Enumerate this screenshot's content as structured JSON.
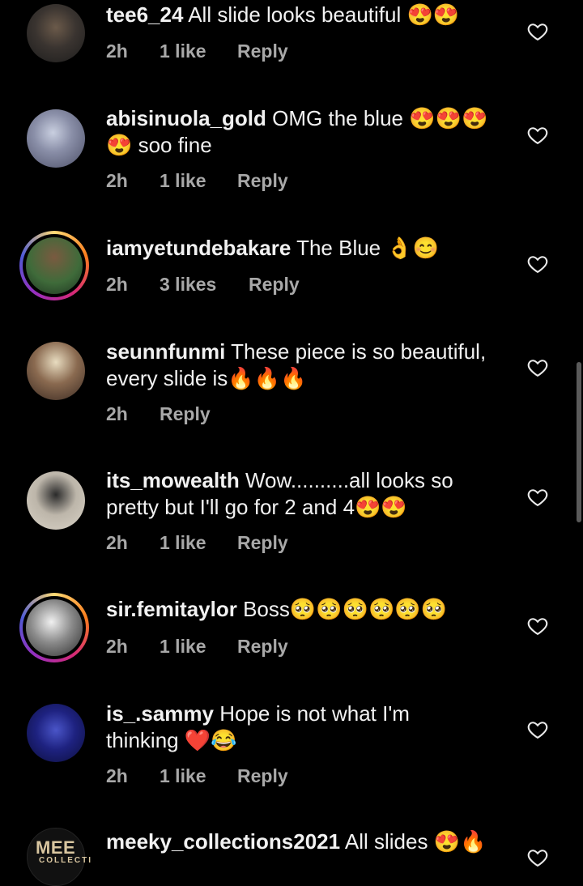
{
  "comments": [
    {
      "username": "tee6_24",
      "text": " All slide looks beautiful 😍😍",
      "time": "2h",
      "likes": "1 like",
      "reply": "Reply"
    },
    {
      "username": "abisinuola_gold",
      "text": " OMG the blue 😍😍😍 😍 soo fine",
      "time": "2h",
      "likes": "1 like",
      "reply": "Reply"
    },
    {
      "username": "iamyetundebakare",
      "text": " The Blue 👌😊",
      "time": "2h",
      "likes": "3 likes",
      "reply": "Reply"
    },
    {
      "username": "seunnfunmi",
      "text": " These piece is so beautiful, every slide is🔥🔥🔥",
      "time": "2h",
      "likes": "",
      "reply": "Reply"
    },
    {
      "username": "its_mowealth",
      "text": " Wow..........all looks so pretty but I'll go for 2 and 4😍😍",
      "time": "2h",
      "likes": "1 like",
      "reply": "Reply"
    },
    {
      "username": "sir.femitaylor",
      "text": " Boss🥺🥺🥺🥺🥺🥺",
      "time": "2h",
      "likes": "1 like",
      "reply": "Reply"
    },
    {
      "username": "is_.sammy",
      "text": " Hope  is not what I'm thinking ❤️😂",
      "time": "2h",
      "likes": "1 like",
      "reply": "Reply"
    },
    {
      "username": "meeky_collections2021",
      "text": " All slides 😍🔥",
      "time": "",
      "likes": "",
      "reply": ""
    }
  ],
  "logo": {
    "line1": "MEE",
    "line2": "COLLECTI"
  },
  "colors": {
    "background": "#000000",
    "text": "#f1f1f1",
    "meta": "#a8a8a8"
  }
}
